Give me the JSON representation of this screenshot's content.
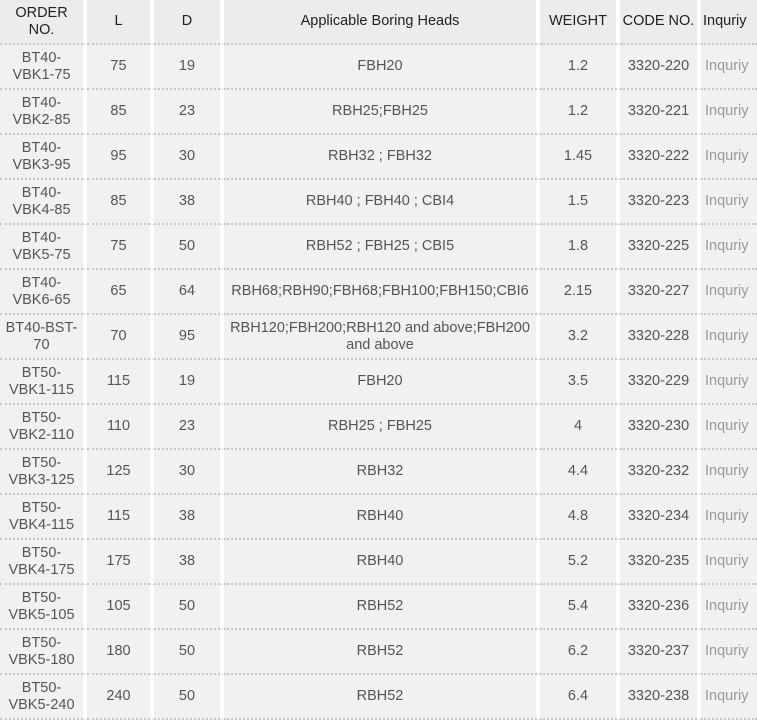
{
  "headers": {
    "order": "ORDER NO.",
    "l": "L",
    "d": "D",
    "heads": "Applicable Boring Heads",
    "weight": "WEIGHT",
    "code": "CODE NO.",
    "inquiry": "Inquriy"
  },
  "rows": [
    {
      "order": "BT40-VBK1-75",
      "l": "75",
      "d": "19",
      "heads": "FBH20",
      "weight": "1.2",
      "code": "3320-220",
      "inquiry": "Inquriy"
    },
    {
      "order": "BT40-VBK2-85",
      "l": "85",
      "d": "23",
      "heads": "RBH25;FBH25",
      "weight": "1.2",
      "code": "3320-221",
      "inquiry": "Inquriy"
    },
    {
      "order": "BT40-VBK3-95",
      "l": "95",
      "d": "30",
      "heads": "RBH32 ; FBH32",
      "weight": "1.45",
      "code": "3320-222",
      "inquiry": "Inquriy"
    },
    {
      "order": "BT40-VBK4-85",
      "l": "85",
      "d": "38",
      "heads": "RBH40 ; FBH40 ; CBI4",
      "weight": "1.5",
      "code": "3320-223",
      "inquiry": "Inquriy"
    },
    {
      "order": "BT40-VBK5-75",
      "l": "75",
      "d": "50",
      "heads": "RBH52 ; FBH25 ; CBI5",
      "weight": "1.8",
      "code": "3320-225",
      "inquiry": "Inquriy"
    },
    {
      "order": "BT40-VBK6-65",
      "l": "65",
      "d": "64",
      "heads": "RBH68;RBH90;FBH68;FBH100;FBH150;CBI6",
      "weight": "2.15",
      "code": "3320-227",
      "inquiry": "Inquriy"
    },
    {
      "order": "BT40-BST-70",
      "l": "70",
      "d": "95",
      "heads": "RBH120;FBH200;RBH120 and above;FBH200 and above",
      "weight": "3.2",
      "code": "3320-228",
      "inquiry": "Inquriy"
    },
    {
      "order": "BT50-VBK1-115",
      "l": "115",
      "d": "19",
      "heads": "FBH20",
      "weight": "3.5",
      "code": "3320-229",
      "inquiry": "Inquriy"
    },
    {
      "order": "BT50-VBK2-110",
      "l": "110",
      "d": "23",
      "heads": "RBH25 ; FBH25",
      "weight": "4",
      "code": "3320-230",
      "inquiry": "Inquriy"
    },
    {
      "order": "BT50-VBK3-125",
      "l": "125",
      "d": "30",
      "heads": "RBH32",
      "weight": "4.4",
      "code": "3320-232",
      "inquiry": "Inquriy"
    },
    {
      "order": "BT50-VBK4-115",
      "l": "115",
      "d": "38",
      "heads": "RBH40",
      "weight": "4.8",
      "code": "3320-234",
      "inquiry": "Inquriy"
    },
    {
      "order": "BT50-VBK4-175",
      "l": "175",
      "d": "38",
      "heads": "RBH40",
      "weight": "5.2",
      "code": "3320-235",
      "inquiry": "Inquriy"
    },
    {
      "order": "BT50-VBK5-105",
      "l": "105",
      "d": "50",
      "heads": "RBH52",
      "weight": "5.4",
      "code": "3320-236",
      "inquiry": "Inquriy"
    },
    {
      "order": "BT50-VBK5-180",
      "l": "180",
      "d": "50",
      "heads": "RBH52",
      "weight": "6.2",
      "code": "3320-237",
      "inquiry": "Inquriy"
    },
    {
      "order": "BT50-VBK5-240",
      "l": "240",
      "d": "50",
      "heads": "RBH52",
      "weight": "6.4",
      "code": "3320-238",
      "inquiry": "Inquriy"
    }
  ]
}
